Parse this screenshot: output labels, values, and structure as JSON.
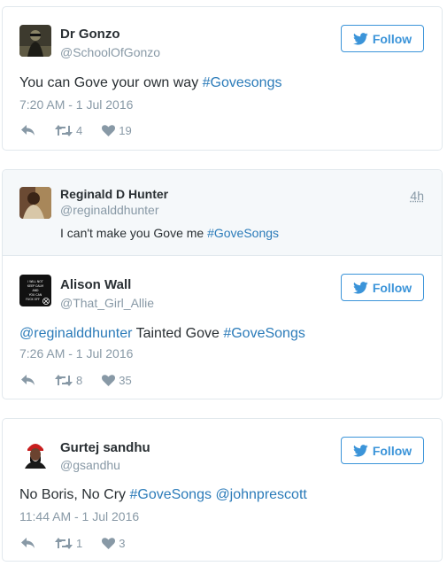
{
  "follow_label": "Follow",
  "tweets": [
    {
      "name": "Dr Gonzo",
      "handle": "@SchoolOfGonzo",
      "text_plain": "You can Gove your own way ",
      "hashtag": "#Govesongs",
      "timestamp": "7:20 AM - 1 Jul 2016",
      "retweets": "4",
      "likes": "19"
    },
    {
      "quoted": {
        "name": "Reginald D Hunter",
        "handle": "@reginalddhunter",
        "age": "4h",
        "text_plain": "I can't make you Gove me ",
        "hashtag": "#GoveSongs"
      },
      "name": "Alison Wall",
      "handle": "@That_Girl_Allie",
      "mention": "@reginalddhunter",
      "text_plain": " Tainted Gove ",
      "hashtag": "#GoveSongs",
      "timestamp": "7:26 AM - 1 Jul 2016",
      "retweets": "8",
      "likes": "35",
      "avatar_text": "I WILL NOT KEEP CALM AND YOU CAN FUCK OFF"
    },
    {
      "name": "Gurtej sandhu",
      "handle": "@gsandhu",
      "text_plain": "No Boris, No Cry ",
      "hashtag": "#GoveSongs",
      "text_space": " ",
      "mention": "@johnprescott",
      "timestamp": "11:44 AM - 1 Jul 2016",
      "retweets": "1",
      "likes": "3"
    }
  ],
  "icons": {
    "follow": "bird-icon",
    "reply": "reply-icon",
    "retweet": "retweet-icon",
    "like": "heart-icon"
  },
  "colors": {
    "link": "#2b7bb9",
    "meta": "#8899a6",
    "button": "#3b94d9",
    "border": "#e1e8ed"
  }
}
